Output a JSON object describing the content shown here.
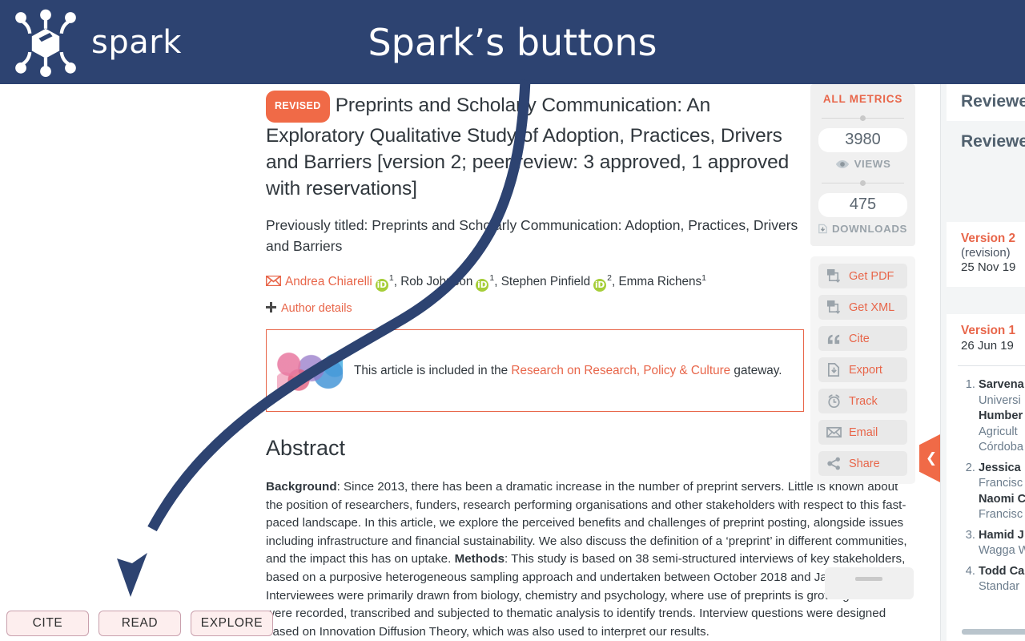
{
  "header": {
    "brand_word": "spark",
    "title": "Spark’s buttons",
    "logo_icon": "spark-hexagon-node-logo",
    "bg_color": "#2d4371"
  },
  "article": {
    "badge": "REVISED",
    "title": "Preprints and Scholarly Communication: An Exploratory Qualitative Study of Adoption, Practices, Drivers and Barriers [version 2; peer review: 3 approved, 1 approved with reservations]",
    "previously_titled": "Previously titled: Preprints and Scholarly Communication: Adoption, Practices, Drivers and Barriers",
    "authors": [
      {
        "name": "Andrea Chiarelli",
        "orcid": true,
        "affiliation": "1",
        "is_corresponding": true
      },
      {
        "name": "Rob Johnson",
        "orcid": true,
        "affiliation": "1",
        "is_corresponding": false
      },
      {
        "name": "Stephen Pinfield",
        "orcid": true,
        "affiliation": "2",
        "is_corresponding": false
      },
      {
        "name": "Emma Richens",
        "orcid": false,
        "affiliation": "1",
        "is_corresponding": false
      }
    ],
    "author_details_label": "Author details",
    "gateway": {
      "prefix": "This article is included in the ",
      "link": "Research on Research, Policy & Culture",
      "suffix": " gateway."
    },
    "abstract_heading": "Abstract",
    "abstract": [
      {
        "label": "Background",
        "text": ": Since 2013, there has been a dramatic increase in the number of preprint servers. Little is known about the position of researchers, funders, research performing organisations and other stakeholders with respect to this fast-paced landscape. In this article, we explore the perceived benefits and challenges of preprint posting, alongside issues including infrastructure and financial sustainability. We also discuss the definition of a ‘preprint’ in different communities, and the impact this has on uptake."
      },
      {
        "label": "Methods",
        "text": ": This study is based on 38 semi-structured interviews of key stakeholders, based on a purposive heterogeneous sampling approach and undertaken between October 2018 and January 2019. Interviewees were primarily drawn from biology, chemistry and psychology, where use of preprints is growing. Interviews were recorded, transcribed and subjected to thematic analysis to identify trends. Interview questions were designed based on Innovation Diffusion Theory, which was also used to interpret our results."
      }
    ]
  },
  "metrics": {
    "title": "ALL METRICS",
    "items": [
      {
        "value": "3980",
        "label": "VIEWS",
        "icon": "eye-icon"
      },
      {
        "value": "475",
        "label": "DOWNLOADS",
        "icon": "download-icon"
      }
    ]
  },
  "action_buttons": [
    {
      "label": "Get PDF",
      "icon": "pdf-download-icon"
    },
    {
      "label": "Get XML",
      "icon": "xml-download-icon"
    },
    {
      "label": "Cite",
      "icon": "quote-icon"
    },
    {
      "label": "Export",
      "icon": "export-icon"
    },
    {
      "label": "Track",
      "icon": "alarm-clock-icon"
    },
    {
      "label": "Email",
      "icon": "envelope-icon"
    },
    {
      "label": "Share",
      "icon": "share-nodes-icon"
    }
  ],
  "sidebar": {
    "heading_1": "Reviewer",
    "heading_2": "Reviewer",
    "versions": [
      {
        "name": "Version 2",
        "sub": "(revision)",
        "date": "25 Nov 19"
      },
      {
        "name": "Version 1",
        "sub": "",
        "date": "26 Jun 19"
      }
    ],
    "reviewers": [
      {
        "num": "1.",
        "lines": [
          "Sarvena",
          "Universi",
          "Humber",
          "Agricult",
          "Córdoba"
        ],
        "bold": [
          true,
          false,
          true,
          false,
          false
        ]
      },
      {
        "num": "2.",
        "lines": [
          "Jessica",
          "Francisc",
          "Naomi C",
          "Francisc"
        ],
        "bold": [
          true,
          false,
          true,
          false
        ]
      },
      {
        "num": "3.",
        "lines": [
          "Hamid J",
          "Wagga W"
        ],
        "bold": [
          true,
          false
        ]
      },
      {
        "num": "4.",
        "lines": [
          "Todd Ca",
          "Standar"
        ],
        "bold": [
          true,
          false
        ]
      }
    ],
    "collapse_tab_icon": "chevron-left-icon"
  },
  "spark_buttons": [
    {
      "label": "CITE"
    },
    {
      "label": "READ"
    },
    {
      "label": "EXPLORE"
    }
  ],
  "annotation": {
    "arrow_color": "#2d4371",
    "points_to": "CITE"
  }
}
